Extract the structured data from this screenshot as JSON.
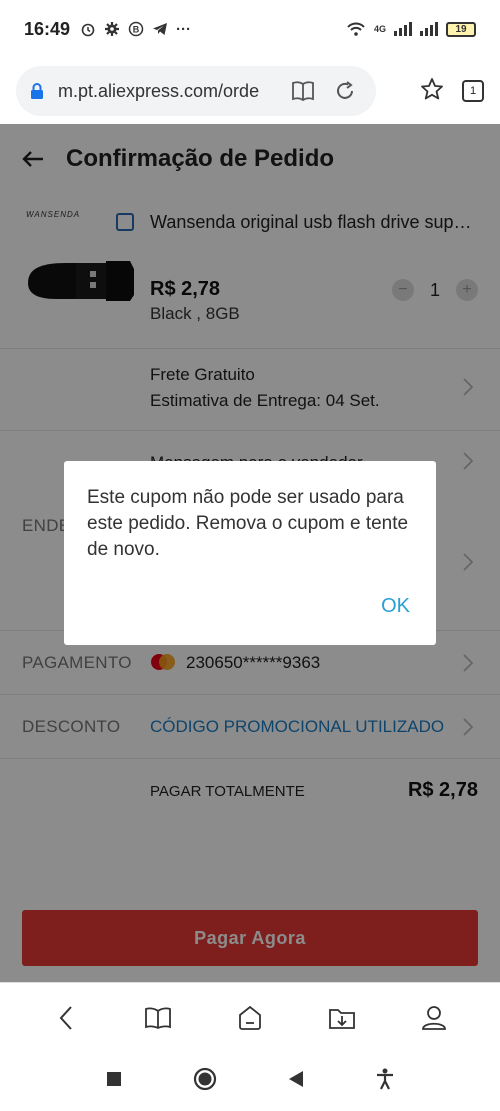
{
  "status_bar": {
    "time": "16:49",
    "more": "···",
    "network": "4G",
    "battery": "19"
  },
  "browser": {
    "url": "m.pt.aliexpress.com/orde",
    "tabs_count": "1"
  },
  "page": {
    "title": "Confirmação de Pedido",
    "brand": "WANSENDA",
    "product": {
      "title": "Wansenda original usb flash drive super...",
      "price": "R$ 2,78",
      "variant": "Black ,  8GB",
      "quantity": "1",
      "minus": "−",
      "plus": "+"
    },
    "shipping": {
      "line1": "Frete Gratuito",
      "line2": "Estimativa de Entrega: 04 Set."
    },
    "message": "Mensagem para o vendedor",
    "address_label": "ENDE",
    "payment": {
      "label": "PAGAMENTO",
      "card": "230650******9363"
    },
    "discount": {
      "label": "DESCONTO",
      "value": "CÓDIGO PROMOCIONAL UTILIZADO"
    },
    "total": {
      "label": "PAGAR TOTALMENTE",
      "value": "R$ 2,78"
    },
    "pay_button": "Pagar Agora"
  },
  "dialog": {
    "message": "Este cupom não pode ser usado para este pedido. Remova o cupom e tente de novo.",
    "ok": "OK"
  },
  "colors": {
    "accent_red": "#e53935",
    "link_blue": "#2a9fd6",
    "promo_blue": "#1c7cc4"
  }
}
